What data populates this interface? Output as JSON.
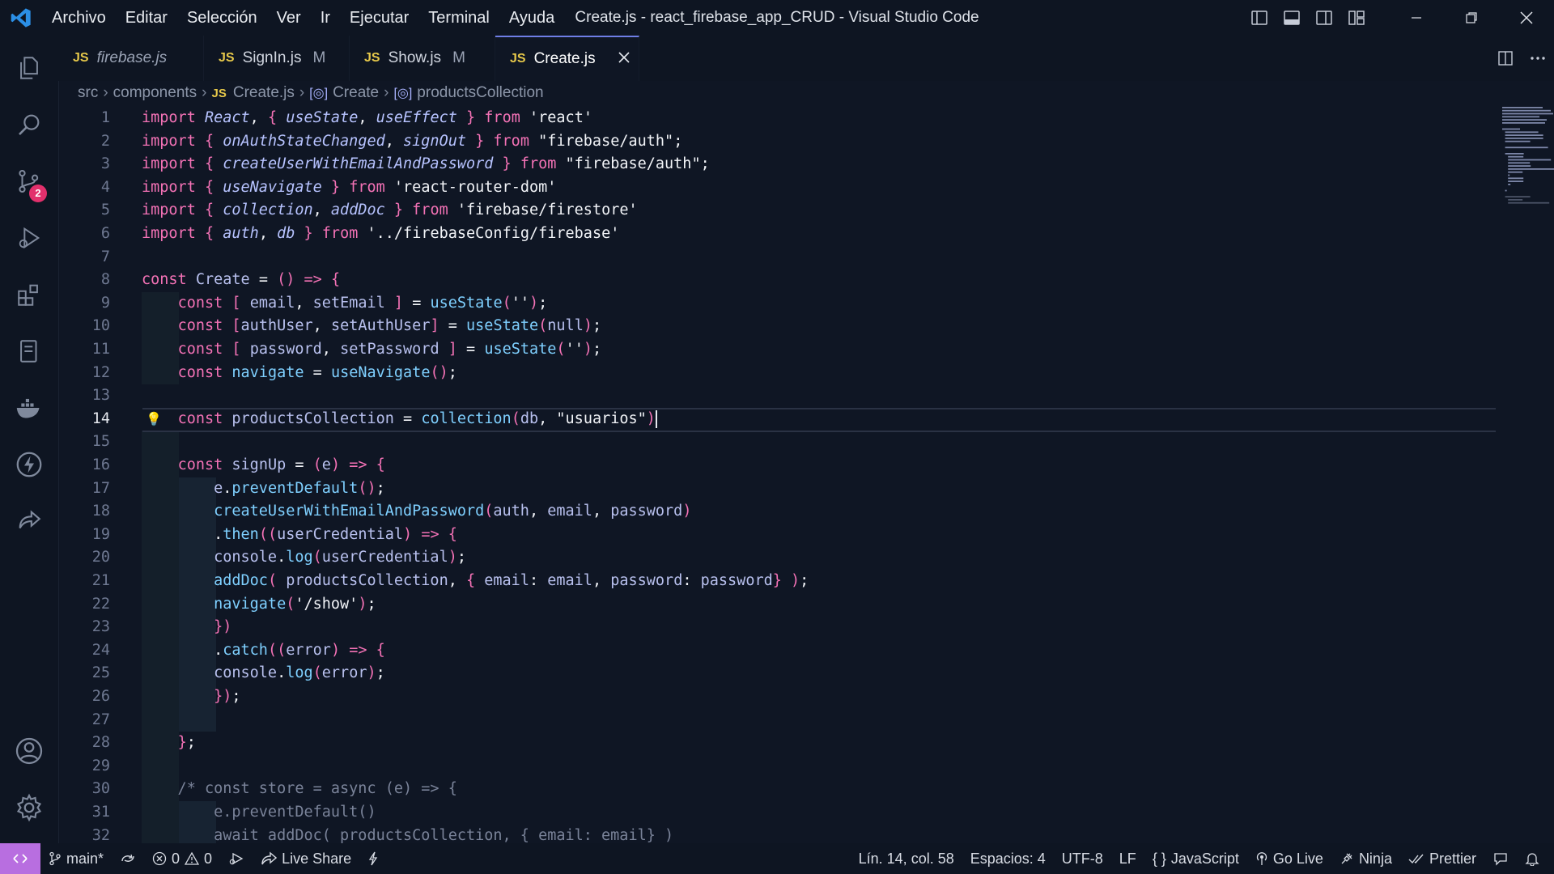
{
  "titlebar": {
    "menu": [
      "Archivo",
      "Editar",
      "Selección",
      "Ver",
      "Ir",
      "Ejecutar",
      "Terminal",
      "Ayuda"
    ],
    "title": "Create.js - react_firebase_app_CRUD - Visual Studio Code"
  },
  "activity": {
    "scm_badge": "2"
  },
  "tabs": [
    {
      "icon": "JS",
      "label": "firebase.js",
      "modified": "",
      "italic": true
    },
    {
      "icon": "JS",
      "label": "SignIn.js",
      "modified": "M",
      "italic": false
    },
    {
      "icon": "JS",
      "label": "Show.js",
      "modified": "M",
      "italic": false
    },
    {
      "icon": "JS",
      "label": "Create.js",
      "modified": "",
      "italic": false,
      "active": true
    }
  ],
  "breadcrumb": [
    "src",
    "components",
    "Create.js",
    "Create",
    "productsCollection"
  ],
  "breadcrumb_js": "JS",
  "editor": {
    "current_line": 14,
    "lines": [
      "import React, { useState, useEffect } from 'react'",
      "import { onAuthStateChanged, signOut } from \"firebase/auth\";",
      "import { createUserWithEmailAndPassword } from \"firebase/auth\";",
      "import { useNavigate } from 'react-router-dom'",
      "import { collection, addDoc } from 'firebase/firestore'",
      "import { auth, db } from '../firebaseConfig/firebase'",
      "",
      "const Create = () => {",
      "    const [ email, setEmail ] = useState('');",
      "    const [authUser, setAuthUser] = useState(null);",
      "    const [ password, setPassword ] = useState('');",
      "    const navigate = useNavigate();",
      "",
      "    const productsCollection = collection(db, \"usuarios\")",
      "",
      "    const signUp = (e) => {",
      "        e.preventDefault();",
      "        createUserWithEmailAndPassword(auth, email, password)",
      "        .then((userCredential) => {",
      "        console.log(userCredential);",
      "        addDoc( productsCollection, { email: email, password: password} );",
      "        navigate('/show');",
      "        })",
      "        .catch((error) => {",
      "        console.log(error);",
      "        });",
      "",
      "    };",
      "",
      "    /* const store = async (e) => {",
      "        e.preventDefault()",
      "        await addDoc( productsCollection, { email: email} )"
    ]
  },
  "statusbar": {
    "branch": "main*",
    "errors": "0",
    "warnings": "0",
    "live_share": "Live Share",
    "position": "Lín. 14, col. 58",
    "spaces": "Espacios: 4",
    "encoding": "UTF-8",
    "eol": "LF",
    "language_icon": "{ }",
    "language": "JavaScript",
    "go_live": "Go Live",
    "ninja": "Ninja",
    "prettier": "Prettier"
  },
  "colors": {
    "background": "#0f1624",
    "accent": "#6f7ee6",
    "badge": "#e2306c",
    "remote": "#b86ee0",
    "keyword": "#f472b6",
    "js_icon": "#e6c84a"
  }
}
